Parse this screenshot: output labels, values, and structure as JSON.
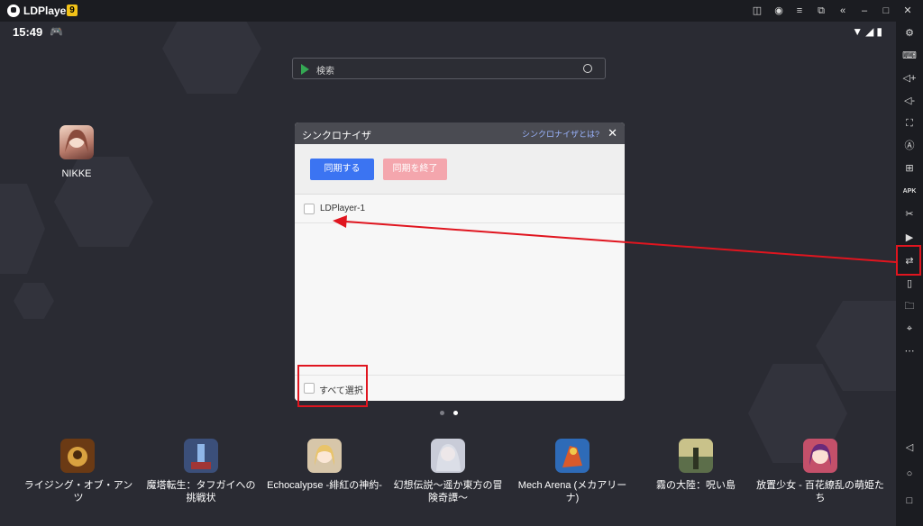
{
  "titlebar": {
    "app_name": "LDPlayer",
    "version_badge": "9",
    "icons": [
      "gamepad-icon",
      "account-icon",
      "menu-icon",
      "export-icon",
      "collapse-icon",
      "minimize-icon",
      "maximize-icon",
      "close-icon",
      "expand-sidebar-icon"
    ]
  },
  "statusbar": {
    "time": "15:49"
  },
  "search": {
    "placeholder": "検索"
  },
  "desktop_apps": [
    {
      "label": "NIKKE",
      "icon": "nikke-icon"
    }
  ],
  "dialog": {
    "title": "シンクロナイザ",
    "help_link": "シンクロナイザとは?",
    "sync_button": "同期する",
    "stop_button": "同期を終了",
    "instances": [
      {
        "name": "LDPlayer-1",
        "checked": false
      }
    ],
    "select_all_label": "すべて選択"
  },
  "dock": {
    "apps": [
      {
        "label": "ライジング・オブ・アンツ",
        "color": "#6b3a14"
      },
      {
        "label": "魔塔転生：タフガイへの挑戦状",
        "color": "#3b4f7a"
      },
      {
        "label": "Echocalypse -緋紅の神約-",
        "color": "#d7c6a9"
      },
      {
        "label": "幻想伝説〜遥か東方の冒険奇譚〜",
        "color": "#c9ccd8"
      },
      {
        "label": "Mech Arena (メカアリーナ)",
        "color": "#d95a2b"
      },
      {
        "label": "霧の大陸：呪い島",
        "color": "#5c6e4a"
      },
      {
        "label": "放置少女 - 百花繚乱の萌姫たち",
        "color": "#c4506a"
      }
    ]
  },
  "pager": {
    "pages": 2,
    "current": 2
  },
  "sidebar": {
    "icons": [
      "settings-icon",
      "keyboard-icon",
      "volume-up-icon",
      "volume-down-icon",
      "screenshot-icon",
      "auto-icon",
      "add-app-icon",
      "apk-icon",
      "scissors-icon",
      "record-icon",
      "synchronizer-icon",
      "shake-icon",
      "folder-icon",
      "location-icon",
      "more-icon",
      "back-icon",
      "home-icon",
      "recents-icon"
    ]
  },
  "colors": {
    "accent_blue": "#3b74f2",
    "disabled_pink": "#f4a6ad",
    "annotation_red": "#e0151f"
  }
}
